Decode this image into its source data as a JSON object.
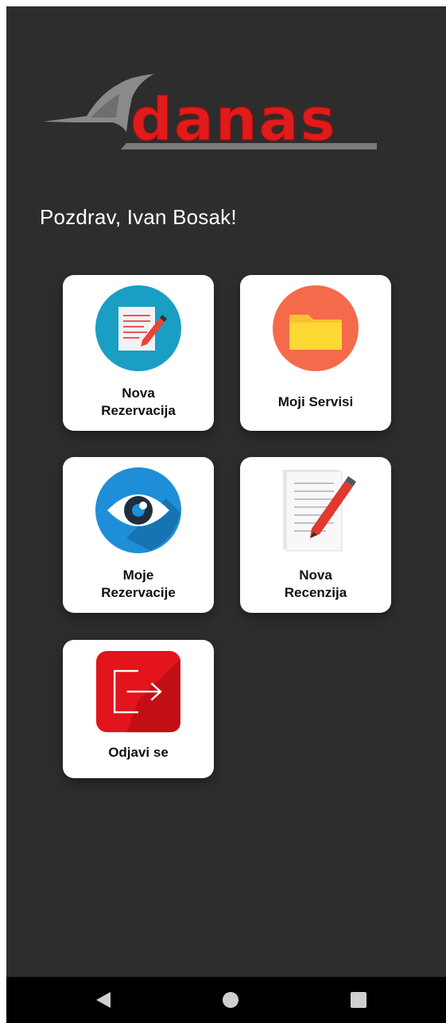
{
  "app": {
    "logo_text": "danas"
  },
  "greeting": "Pozdrav, Ivan Bosak!",
  "tiles": [
    {
      "id": "nova-rezervacija",
      "label": "Nova Rezervacija",
      "icon": "document-pen-icon"
    },
    {
      "id": "moji-servisi",
      "label": "Moji Servisi",
      "icon": "folder-icon"
    },
    {
      "id": "moje-rezervacije",
      "label": "Moje Rezervacije",
      "icon": "eye-icon"
    },
    {
      "id": "nova-recenzija",
      "label": "Nova Recenzija",
      "icon": "review-pen-icon"
    },
    {
      "id": "odjavi-se",
      "label": "Odjavi se",
      "icon": "logout-icon"
    }
  ],
  "navbar": {
    "back_icon": "back-triangle-icon",
    "home_icon": "home-circle-icon",
    "recent_icon": "recent-square-icon"
  },
  "colors": {
    "background": "#2d2d2d",
    "logo_red": "#e01b1b",
    "tile": "#ffffff",
    "logout_red": "#e3141b"
  }
}
